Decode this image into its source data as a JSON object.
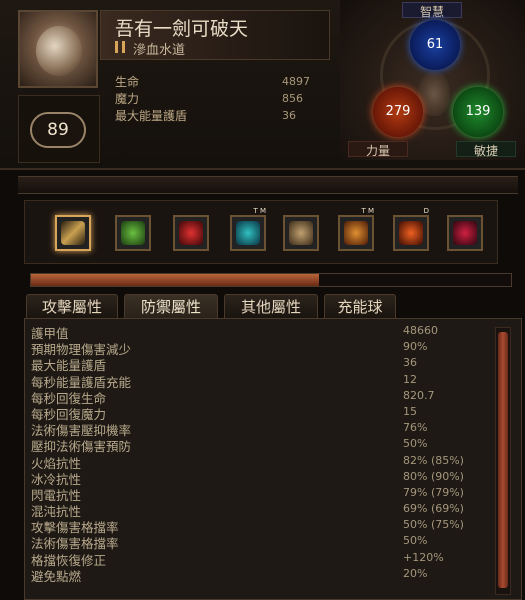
{
  "character": {
    "name": "吾有一劍可破天",
    "class_icon": "ascendancy-icon",
    "class_name": "滲血水道",
    "level": "89"
  },
  "vitals": [
    {
      "label": "生命",
      "value": "4897"
    },
    {
      "label": "魔力",
      "value": "856"
    },
    {
      "label": "最大能量護盾",
      "value": "36"
    }
  ],
  "attributes": {
    "int_label": "智慧",
    "int_value": "61",
    "str_label": "力量",
    "str_value": "279",
    "dex_label": "敏捷",
    "dex_value": "139"
  },
  "skills": [
    {
      "icon": "sword-icon"
    },
    {
      "icon": "poison-cloud-icon"
    },
    {
      "icon": "blood-vortex-icon"
    },
    {
      "icon": "aura-figure-icon",
      "badge": "T M"
    },
    {
      "icon": "skull-shield-icon"
    },
    {
      "icon": "warrior-strike-icon",
      "badge": "T M"
    },
    {
      "icon": "fire-burst-icon",
      "badge": "D"
    },
    {
      "icon": "red-portal-icon"
    }
  ],
  "experience_progress": 0.6,
  "tabs": [
    "攻擊屬性",
    "防禦屬性",
    "其他屬性",
    "充能球"
  ],
  "active_tab": 1,
  "stats": [
    {
      "label": "護甲值",
      "value": "48660"
    },
    {
      "label": "預期物理傷害減少",
      "value": "90%"
    },
    {
      "label": "最大能量護盾",
      "value": "36"
    },
    {
      "label": "每秒能量護盾充能",
      "value": "12"
    },
    {
      "label": "每秒回復生命",
      "value": "820.7"
    },
    {
      "label": "每秒回復魔力",
      "value": "15"
    },
    {
      "label": "法術傷害壓抑機率",
      "value": "76%"
    },
    {
      "label": "壓抑法術傷害預防",
      "value": "50%"
    },
    {
      "label": "火焰抗性",
      "value": "82% (85%)"
    },
    {
      "label": "冰冷抗性",
      "value": "80% (90%)"
    },
    {
      "label": "閃電抗性",
      "value": "79% (79%)"
    },
    {
      "label": "混沌抗性",
      "value": "69% (69%)"
    },
    {
      "label": "攻擊傷害格擋率",
      "value": "50% (75%)"
    },
    {
      "label": "法術傷害格擋率",
      "value": "50%"
    },
    {
      "label": "格擋恢復修正",
      "value": "+120%"
    },
    {
      "label": "避免點燃",
      "value": "20%"
    }
  ]
}
